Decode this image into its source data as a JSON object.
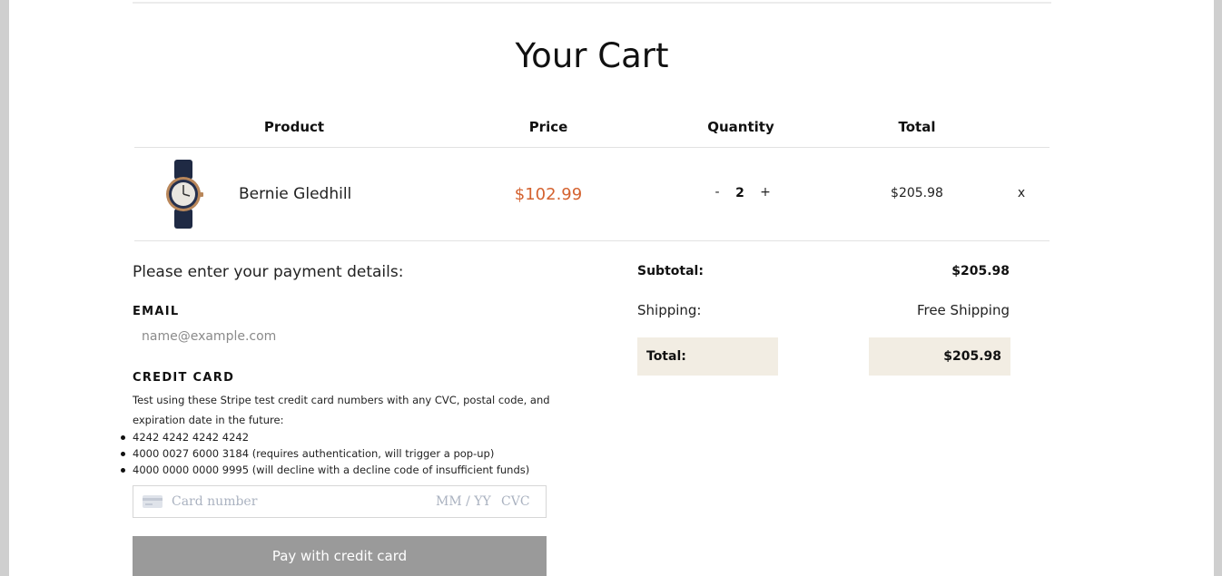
{
  "page": {
    "title": "Your Cart"
  },
  "table": {
    "headers": {
      "product": "Product",
      "price": "Price",
      "quantity": "Quantity",
      "total": "Total"
    },
    "items": [
      {
        "name": "Bernie Gledhill",
        "price": "$102.99",
        "quantity": "2",
        "total": "$205.98",
        "remove": "x",
        "decrement": "-",
        "increment": "+",
        "image_icon": "wristwatch-image"
      }
    ]
  },
  "payment": {
    "heading": "Please enter your payment details:",
    "email_label": "EMAIL",
    "email_placeholder": "name@example.com",
    "credit_card_label": "CREDIT CARD",
    "help_text": "Test using these Stripe test credit card numbers with any CVC, postal code, and expiration date in the future:",
    "test_cards": [
      "4242 4242 4242 4242",
      "4000 0027 6000 3184 (requires authentication, will trigger a pop-up)",
      "4000 0000 0000 9995 (will decline with a decline code of insufficient funds)"
    ],
    "card_field": {
      "icon": "credit-card-icon",
      "number_placeholder": "Card number",
      "expiry_placeholder": "MM / YY",
      "cvc_placeholder": "CVC"
    },
    "pay_button": "Pay with credit card"
  },
  "summary": {
    "subtotal_label": "Subtotal:",
    "subtotal_value": "$205.98",
    "shipping_label": "Shipping:",
    "shipping_value": "Free Shipping",
    "total_label": "Total:",
    "total_value": "$205.98"
  },
  "colors": {
    "price": "#d4622f",
    "total_box": "#f2ede3",
    "pay_button": "#9a9a9a",
    "frame": "#cfcfcf"
  }
}
